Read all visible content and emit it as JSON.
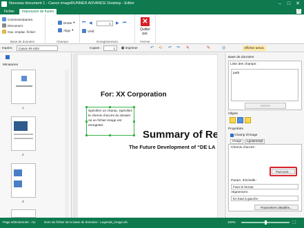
{
  "window": {
    "title": "Nouveau document 1 - Canon imageRUNNER ADVANCE Desktop - Editor",
    "controls": [
      "–",
      "□",
      "✕"
    ]
  },
  "ribbon_tabs": {
    "file": "Fichier",
    "merge": "Impression de fusion",
    "help": "?"
  },
  "ribbon": {
    "db_group": {
      "items": [
        "Connexion/param.",
        "Déconnect",
        "Ouv. emplac. fichier"
      ],
      "label": "Base de données"
    },
    "fields_group": {
      "items": [
        "Droite",
        "Align"
      ],
      "label": "Champs"
    },
    "records_group": {
      "record_value": "1",
      "verify": "Vérif.",
      "label": "Enregistrement"
    },
    "close_group": {
      "close_label": "Quitter",
      "close_label2": "par.",
      "label": "Fermer"
    }
  },
  "toolbar2": {
    "printer_label": "Imprim:",
    "printer_value": "Canon iR-ADV",
    "copies_label": "Copies :",
    "copies_value": "1",
    "print_button": "Imprimer",
    "show_annot": "Afficher annot."
  },
  "left_panel": {
    "title": "Miniatures",
    "pages": [
      "1",
      "2",
      "3"
    ]
  },
  "page_content": {
    "for_line": "For: XX Corporation",
    "summary": "Summary of Res",
    "subtitle": "The Future Development of “DE LA",
    "field_text": "Spécifiez un champ. Spécifiez le chemin d'accès du dossier où un fichier image est enregistré."
  },
  "right_panel": {
    "db_title": "Base de données",
    "fields_list_label": "Liste des champs :",
    "field_item": "path",
    "insert_button": "Insérer",
    "objects_label": "Objets",
    "properties_label": "Propriétés",
    "image_field_checkbox": "Champ d'image",
    "tab_image": "Image",
    "tab_line": "Lgn&rempl",
    "path_label": "Chemin d'accès :",
    "browse_button": "Parcourir...",
    "scale_label": "Param. d'échelle :",
    "scale_value": "Fixer le format",
    "align_label": "Alignement :",
    "align_value": "En haut à gauche",
    "details_button": "Paramètres détaillés..."
  },
  "status": {
    "page_selected": "Page sélectionnée : /11",
    "db_file": "Nom du fichier de la base de données : Legends_image.xls",
    "zoom": "100%"
  },
  "colors": {
    "accent": "#0e7a4e",
    "highlight_red": "#d9202a",
    "field_border": "#3ab34a"
  }
}
